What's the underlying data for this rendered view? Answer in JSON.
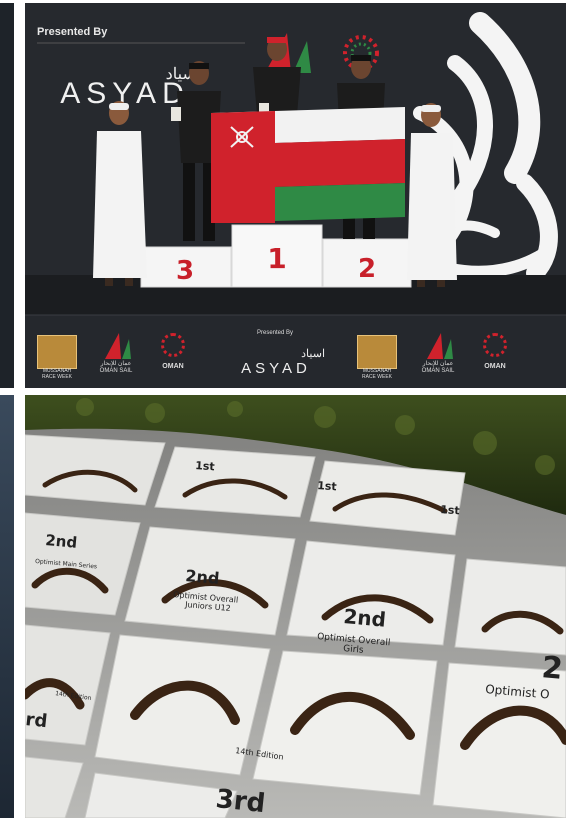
{
  "top_photo": {
    "backdrop": {
      "presented_by": "Presented By",
      "sponsor_arabic": "اسياد",
      "sponsor_latin": "ASYAD",
      "calligraphy": "المصنعة"
    },
    "podium": {
      "place_1": "1",
      "place_2": "2",
      "place_3": "3"
    },
    "banner": {
      "logo_1_line1": "MUSSANAH",
      "logo_1_line2": "RACE WEEK",
      "logo_2_arabic": "عمان للإبحار",
      "logo_2_latin": "OMAN SAIL",
      "logo_3": "OMAN",
      "presented_by": "Presented By",
      "sponsor_arabic": "اسياد",
      "sponsor_latin": "ASYAD"
    },
    "colors": {
      "flag_white": "#f2f2f2",
      "flag_red": "#d0222c",
      "flag_green": "#2f8a45",
      "backdrop": "#26292e"
    }
  },
  "bottom_photo": {
    "plaques": [
      {
        "place": "1st"
      },
      {
        "place": "1st"
      },
      {
        "place": "1st"
      },
      {
        "place": "2nd",
        "line1": "Optimist Main Series"
      },
      {
        "place": "2nd",
        "line1": "Optimist Overall",
        "line2": "Juniors U12"
      },
      {
        "place": "2nd",
        "line1": "Optimist Overall",
        "line2": "Girls"
      },
      {
        "place": "2",
        "line1": "Optimist O"
      },
      {
        "place": "rd"
      },
      {
        "place": "3rd"
      }
    ],
    "edition": "14th Edition"
  }
}
